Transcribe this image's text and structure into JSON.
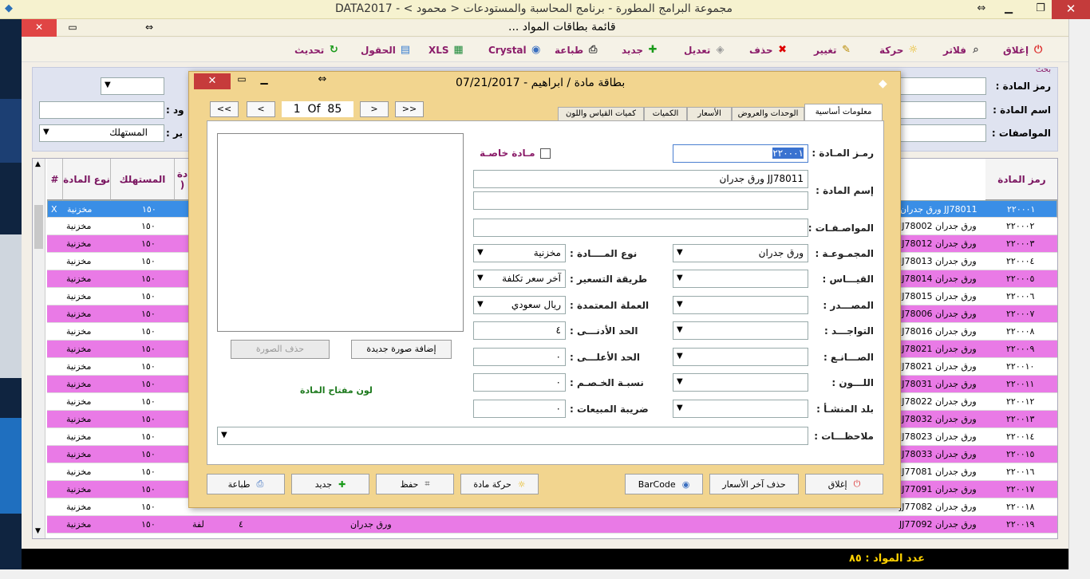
{
  "window": {
    "title": "مجموعة البرامج المطورة - برنامج المحاسبة والمستودعات < محمود > - DATA2017"
  },
  "child": {
    "title": "قائمة بطاقات المواد ..."
  },
  "toolbar": {
    "close": "إغلاق",
    "filters": "فلاتر",
    "movement": "حركة",
    "change": "تغيير",
    "delete": "حذف",
    "edit": "تعديل",
    "new": "جديد",
    "print": "طباعة",
    "crystal": "Crystal",
    "xls": "XLS",
    "fields": "الحقول",
    "refresh": "تحديث"
  },
  "search": {
    "section": "بحث",
    "code_label": "رمز المادة :",
    "name_label": "اسم المادة :",
    "specs_label": "المواصفات :",
    "label_partial2": "ود :",
    "label_partial3": "ير :",
    "select3_value": "المستهلك"
  },
  "grid": {
    "headers": {
      "code": "رمز المادة",
      "type": "نوع المادة",
      "consumer": "المستهلك",
      "partial": "دة )",
      "hash": "#"
    },
    "rows": [
      {
        "code": "٢٢٠٠٠١",
        "name": "JJ78011 ورق جدران",
        "consumer": "١٥٠",
        "type": "مخزنية",
        "mark": "X"
      },
      {
        "code": "٢٢٠٠٠٢",
        "name": "JJ78002 ورق جدران",
        "consumer": "١٥٠",
        "type": "مخزنية",
        "mark": ""
      },
      {
        "code": "٢٢٠٠٠٣",
        "name": "JJ78012 ورق جدران",
        "consumer": "١٥٠",
        "type": "مخزنية",
        "mark": ""
      },
      {
        "code": "٢٢٠٠٠٤",
        "name": "JJ78013 ورق جدران",
        "consumer": "١٥٠",
        "type": "مخزنية",
        "mark": ""
      },
      {
        "code": "٢٢٠٠٠٥",
        "name": "JJ78014 ورق جدران",
        "consumer": "١٥٠",
        "type": "مخزنية",
        "mark": ""
      },
      {
        "code": "٢٢٠٠٠٦",
        "name": "JJ78015 ورق جدران",
        "consumer": "١٥٠",
        "type": "مخزنية",
        "mark": ""
      },
      {
        "code": "٢٢٠٠٠٧",
        "name": "JJ78006 ورق جدران",
        "consumer": "١٥٠",
        "type": "مخزنية",
        "mark": ""
      },
      {
        "code": "٢٢٠٠٠٨",
        "name": "JJ78016 ورق جدران",
        "consumer": "١٥٠",
        "type": "مخزنية",
        "mark": ""
      },
      {
        "code": "٢٢٠٠٠٩",
        "name": "JJ78021 ورق جدران",
        "consumer": "١٥٠",
        "type": "مخزنية",
        "mark": ""
      },
      {
        "code": "٢٢٠٠١٠",
        "name": "JJ78021 ورق جدران",
        "consumer": "١٥٠",
        "type": "مخزنية",
        "mark": ""
      },
      {
        "code": "٢٢٠٠١١",
        "name": "JJ78031 ورق جدران",
        "consumer": "١٥٠",
        "type": "مخزنية",
        "mark": ""
      },
      {
        "code": "٢٢٠٠١٢",
        "name": "JJ78022 ورق جدران",
        "consumer": "١٥٠",
        "type": "مخزنية",
        "mark": ""
      },
      {
        "code": "٢٢٠٠١٣",
        "name": "JJ78032 ورق جدران",
        "consumer": "١٥٠",
        "type": "مخزنية",
        "mark": ""
      },
      {
        "code": "٢٢٠٠١٤",
        "name": "JJ78023 ورق جدران",
        "consumer": "١٥٠",
        "type": "مخزنية",
        "mark": ""
      },
      {
        "code": "٢٢٠٠١٥",
        "name": "JJ78033 ورق جدران",
        "consumer": "١٥٠",
        "type": "مخزنية",
        "mark": ""
      },
      {
        "code": "٢٢٠٠١٦",
        "name": "JJ77081 ورق جدران",
        "consumer": "١٥٠",
        "type": "مخزنية",
        "mark": ""
      },
      {
        "code": "٢٢٠٠١٧",
        "name": "JJ77091 ورق جدران",
        "consumer": "١٥٠",
        "type": "مخزنية",
        "mark": ""
      },
      {
        "code": "٢٢٠٠١٨",
        "name": "JJ77082 ورق جدران",
        "consumer": "١٥٠",
        "type": "مخزنية",
        "mark": ""
      },
      {
        "code": "٢٢٠٠١٩",
        "name": "JJ77092 ورق جدران",
        "consumer": "١٥٠",
        "type": "مخزنية",
        "mark": ""
      }
    ],
    "row19_extra": {
      "name2": "ورق جدران",
      "qty": "٤",
      "unit": "لفة"
    }
  },
  "status": {
    "count": "عدد المواد : ٨٥"
  },
  "dialog": {
    "title": "بطاقة مادة /  ابراهيم - 07/21/2017",
    "nav": {
      "first": "<<",
      "prev": "<",
      "pos": "1  Of  85",
      "next": ">",
      "last": ">>"
    },
    "tabs": [
      "معلومات أساسية",
      "الوحدات والعروض",
      "الأسعار",
      "الكميات",
      "كميات القياس واللون"
    ],
    "fields": {
      "code_label": "رمـز المـادة :",
      "code_value": "٢٢٠٠٠١",
      "special_label": "مـادة خاصـة",
      "name_label": "إسم المادة :",
      "name_value": "JJ78011 ورق جدران",
      "specs_label": "المواصـفـات :",
      "group_label": "المجمـوعـة :",
      "group_value": "ورق جدران",
      "type_label": "نوع المــــادة :",
      "type_value": "مخزنية",
      "measure_label": "القيـــاس :",
      "pricing_label": "طريقة التسعير :",
      "pricing_value": "آخر سعر تكلفة",
      "source_label": "المصـــدر :",
      "currency_label": "العملة المعتمدة :",
      "currency_value": "ريال سعودي",
      "agent_label": "التواجـــد :",
      "min_label": "الحد الأدنـــى :",
      "min_value": "٤",
      "maker_label": "الصـــانـع :",
      "max_label": "الحد الأعلـــى :",
      "max_value": "٠",
      "color_label": "اللـــون :",
      "discount_label": "نسبـة الخـصـم :",
      "discount_value": "٠",
      "origin_label": "بلد المنشـأ :",
      "tax_label": "ضريبة المبيعات :",
      "tax_value": "٠",
      "notes_label": "ملاحظـــات :"
    },
    "image": {
      "add": "إضافة صورة جديدة",
      "delete": "حذف الصورة",
      "color_key": "لون مفتاح المادة"
    },
    "footer": {
      "close": "إغلاق",
      "delete_prices": "حذف آخر الأسعار",
      "barcode": "BarCode",
      "movement": "حركة مادة",
      "save": "حفظ",
      "new": "جديد",
      "print": "طباعة"
    }
  }
}
